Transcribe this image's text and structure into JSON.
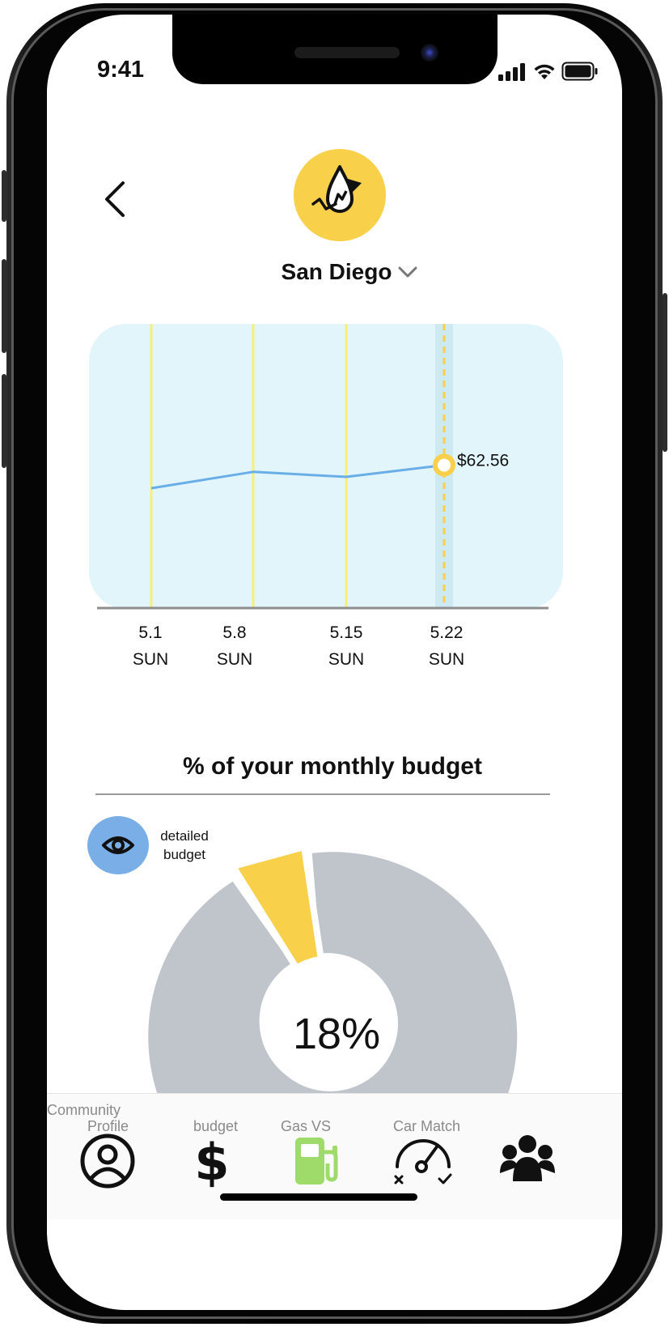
{
  "status_bar": {
    "time": "9:41"
  },
  "header": {
    "back_icon": "chevron-left-icon",
    "logo_icon": "fuel-drop-icon",
    "city": "San Diego",
    "city_dropdown_icon": "chevron-down-icon"
  },
  "colors": {
    "accent_yellow": "#f9d04a",
    "chart_bg": "#e1f5fa",
    "line_blue": "#6aaee8",
    "pie_gray": "#c0c5cc",
    "eye_blue": "#7aaee6",
    "gas_green": "#9edb6a"
  },
  "chart_data": {
    "type": "line",
    "categories": [
      "5.1",
      "5.8",
      "5.15",
      "5.22"
    ],
    "weekday_labels": [
      "SUN",
      "SUN",
      "SUN",
      "SUN"
    ],
    "series": [
      {
        "values": [
          58.9,
          61.5,
          60.7,
          62.56
        ]
      }
    ],
    "highlighted_index": 3,
    "highlight_label": "$62.56",
    "ylim": [
      40,
      85
    ],
    "grid": true
  },
  "budget": {
    "title": "% of your monthly budget",
    "detail_label_line1": "detailed",
    "detail_label_line2": "budget",
    "percent_label": "18%",
    "percent_value": 18
  },
  "tabbar": {
    "tabs": [
      {
        "label_top": "Community",
        "label": "Profile",
        "icon": "user-circle-icon"
      },
      {
        "label": "budget",
        "icon": "dollar-icon"
      },
      {
        "label": "Gas VS",
        "icon": "gas-pump-icon"
      },
      {
        "label": "Car Match",
        "icon": "speedometer-icon"
      },
      {
        "label": "",
        "icon": "community-group-icon"
      }
    ]
  }
}
